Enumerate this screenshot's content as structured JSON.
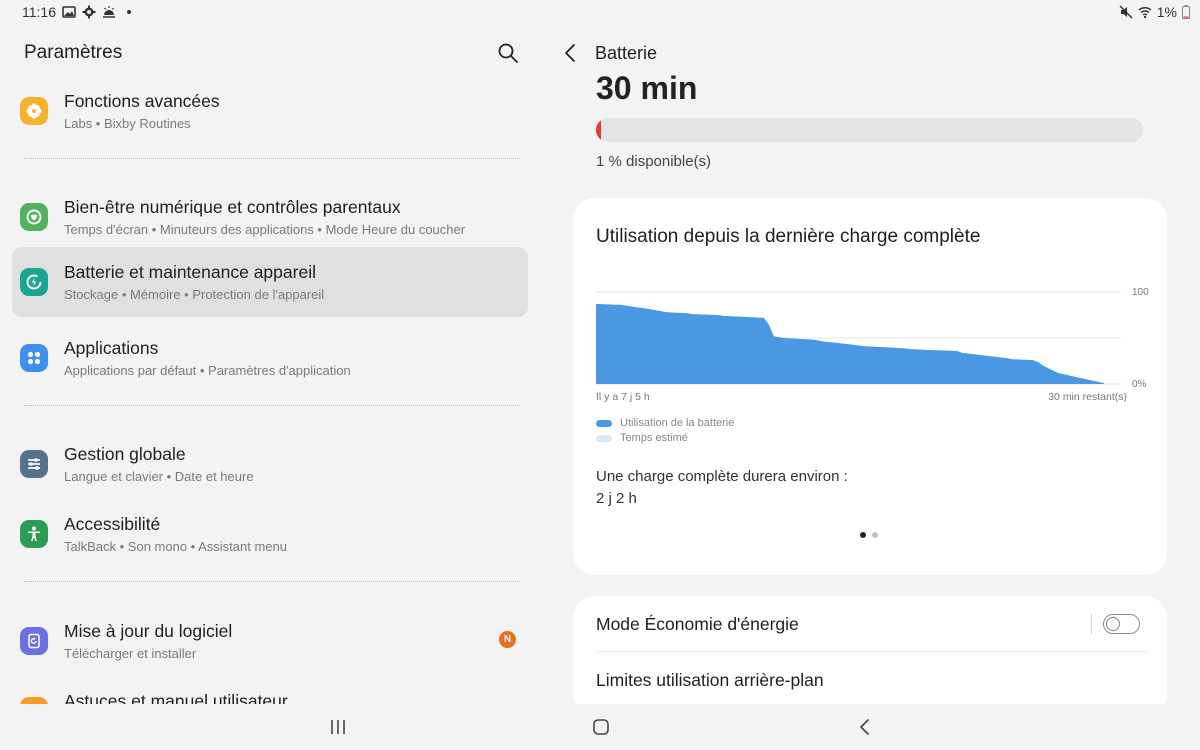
{
  "statusbar": {
    "time": "11:16",
    "battery_text": "1%",
    "left_icons": [
      "image-icon",
      "gear-icon",
      "weather-icon",
      "dot-icon"
    ],
    "right_icons": [
      "mute-icon",
      "wifi-icon",
      "battery-icon"
    ]
  },
  "left": {
    "title": "Paramètres",
    "items": [
      {
        "title": "Fonctions avancées",
        "subtitle": "Labs  •  Bixby Routines",
        "icon": "star-gear-icon",
        "color": "#f6b12e"
      },
      {
        "title": "Bien-être numérique et contrôles parentaux",
        "subtitle": "Temps d'écran  •  Minuteurs des applications  •  Mode Heure du coucher",
        "icon": "wellbeing-icon",
        "color": "#52b25d"
      },
      {
        "title": "Batterie et maintenance appareil",
        "subtitle": "Stockage  •  Mémoire  •  Protection de l'appareil",
        "icon": "battery-care-icon",
        "color": "#19a58f"
      },
      {
        "title": "Applications",
        "subtitle": "Applications par défaut  •  Paramètres d'application",
        "icon": "apps-icon",
        "color": "#3d8ff0"
      },
      {
        "title": "Gestion globale",
        "subtitle": "Langue et clavier  •  Date et heure",
        "icon": "sliders-icon",
        "color": "#56738c"
      },
      {
        "title": "Accessibilité",
        "subtitle": "TalkBack  •  Son mono  •  Assistant menu",
        "icon": "accessibility-icon",
        "color": "#2c9c52"
      },
      {
        "title": "Mise à jour du logiciel",
        "subtitle": "Télécharger et installer",
        "icon": "update-icon",
        "color": "#6b6fe0",
        "badge": "N"
      },
      {
        "title": "Astuces et manuel utilisateur",
        "subtitle": "",
        "icon": "tips-icon",
        "color": "#f59a2b"
      }
    ]
  },
  "right": {
    "title": "Batterie",
    "remaining": "30 min",
    "available": "1 % disponible(s)",
    "battery_level_percent": 1,
    "usage_card": {
      "title": "Utilisation depuis la dernière charge complète",
      "legend": [
        {
          "label": "Utilisation de la batterie",
          "color": "#4a97e2"
        },
        {
          "label": "Temps estimé",
          "color": "#dbe8f7"
        }
      ],
      "estimate_label": "Une charge complète durera environ :",
      "estimate_value": "2 j 2 h",
      "page_count": 2,
      "active_page": 0
    },
    "settings": {
      "power_saving": "Mode Économie d'énergie",
      "power_saving_on": false,
      "background_limits": "Limites utilisation arrière-plan"
    }
  },
  "chart_data": {
    "type": "area",
    "title": "",
    "xlabel": "",
    "ylabel": "",
    "x_tick_labels": [
      "Il y a 7 j 5 h",
      "30 min restant(s)"
    ],
    "y_tick_labels": [
      "100",
      "0%"
    ],
    "ylim": [
      0,
      100
    ],
    "grid": true,
    "series": [
      {
        "name": "Utilisation de la batterie",
        "x": [
          0,
          0.05,
          0.06,
          0.1,
          0.14,
          0.18,
          0.19,
          0.24,
          0.25,
          0.33,
          0.34,
          0.35,
          0.37,
          0.43,
          0.45,
          0.47,
          0.5,
          0.53,
          0.57,
          0.6,
          0.62,
          0.65,
          0.71,
          0.72,
          0.81,
          0.82,
          0.86,
          0.87,
          0.88,
          0.91,
          0.95,
          1.0
        ],
        "y": [
          87,
          86,
          85,
          82,
          78,
          77,
          76,
          75,
          74,
          72,
          65,
          52,
          50,
          48,
          46,
          45,
          43,
          41,
          40,
          39,
          38,
          37,
          36,
          34,
          28,
          27,
          26,
          24,
          20,
          12,
          7,
          1
        ]
      }
    ],
    "nav": [
      "recents-button",
      "home-button",
      "back-button"
    ]
  }
}
